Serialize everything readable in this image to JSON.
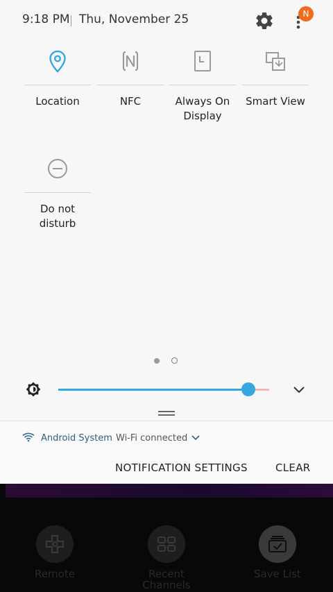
{
  "header": {
    "time": "9:18 PM",
    "date": "Thu, November 25",
    "avatar_letter": "N"
  },
  "tiles": [
    {
      "label": "Location",
      "icon": "location-pin-icon",
      "active": true
    },
    {
      "label": "NFC",
      "icon": "nfc-icon",
      "active": false
    },
    {
      "label": "Always On\nDisplay",
      "icon": "always-on-display-icon",
      "active": false
    },
    {
      "label": "Smart View",
      "icon": "smart-view-icon",
      "active": false
    },
    {
      "label": "Do not\ndisturb",
      "icon": "do-not-disturb-icon",
      "active": false
    }
  ],
  "pager": {
    "pages": 2,
    "current": 1
  },
  "brightness": {
    "level": 0.89
  },
  "notification": {
    "app": "Android System",
    "text": "Wi-Fi connected"
  },
  "actions": {
    "settings": "NOTIFICATION SETTINGS",
    "clear": "CLEAR"
  },
  "bottom_nav": [
    {
      "label": "Remote",
      "icon": "dpad-icon"
    },
    {
      "label": "Recent\nChannels",
      "icon": "grid-icon"
    },
    {
      "label": "Save List",
      "icon": "save-list-icon"
    }
  ],
  "colors": {
    "accent": "#36a8e0",
    "avatar": "#f26b1d"
  }
}
